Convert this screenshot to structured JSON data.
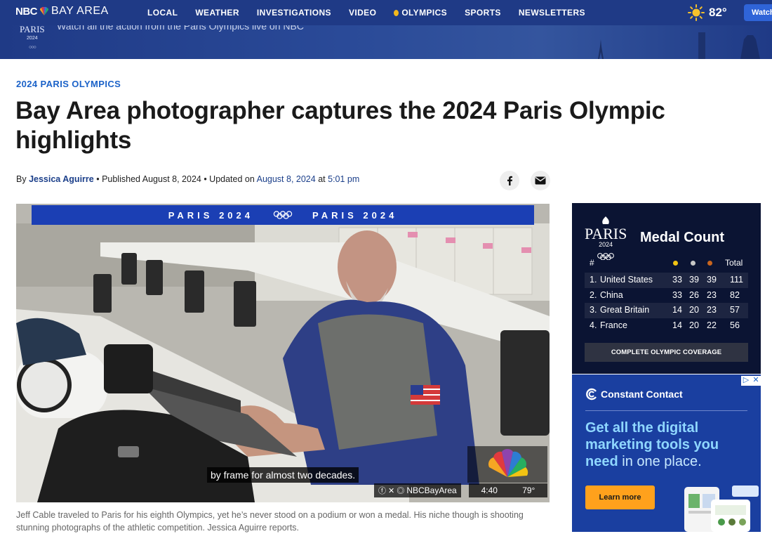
{
  "nav": {
    "brand": "NBC",
    "city": "BAY AREA",
    "items": [
      "LOCAL",
      "WEATHER",
      "INVESTIGATIONS",
      "VIDEO",
      "OLYMPICS",
      "SPORTS",
      "NEWSLETTERS"
    ],
    "temperature": "82°",
    "watch_label": "Watch"
  },
  "banner": {
    "logo_text": "PARIS",
    "logo_year": "2024",
    "cta": "Watch all the action from the Paris Olympics live on NBC"
  },
  "article": {
    "kicker": "2024 PARIS OLYMPICS",
    "headline": "Bay Area photographer captures the 2024 Paris Olympic highlights",
    "byline_prefix": "By",
    "author": "Jessica Aguirre",
    "published": "• Published August 8, 2024 • Updated on",
    "updated_date": "August 8, 2024",
    "at": "at",
    "updated_time": "5:01 pm",
    "caption": "Jeff Cable traveled to Paris for his eighth Olympics, yet he’s never stood on a podium or won a medal. His niche though is shooting stunning photographs of the athletic competition. Jessica Aguirre reports."
  },
  "video": {
    "strip_left": "PARIS 2024",
    "strip_right": "PARIS 2024",
    "subtitle": "by frame for almost two decades.",
    "handle": "NBCBayArea",
    "time": "4:40",
    "temp": "79°"
  },
  "medal_widget": {
    "logo_text": "PARIS",
    "logo_year": "2024",
    "title": "Medal Count",
    "col_rank": "#",
    "col_total": "Total",
    "rows": [
      {
        "rank": "1.",
        "country": "United States",
        "gold": "33",
        "silver": "39",
        "bronze": "39",
        "total": "111"
      },
      {
        "rank": "2.",
        "country": "China",
        "gold": "33",
        "silver": "26",
        "bronze": "23",
        "total": "82"
      },
      {
        "rank": "3.",
        "country": "Great Britain",
        "gold": "14",
        "silver": "20",
        "bronze": "23",
        "total": "57"
      },
      {
        "rank": "4.",
        "country": "France",
        "gold": "14",
        "silver": "20",
        "bronze": "22",
        "total": "56"
      }
    ],
    "coverage_label": "COMPLETE OLYMPIC COVERAGE",
    "colors": {
      "gold": "#f2c313",
      "silver": "#c7c7c7",
      "bronze": "#c8651e"
    }
  },
  "ad": {
    "brand": "Constant Contact",
    "headline_bold": "Get all the digital marketing tools you need",
    "headline_rest": "in one place.",
    "cta": "Learn more",
    "adchoices": [
      "▷",
      "✕"
    ]
  }
}
